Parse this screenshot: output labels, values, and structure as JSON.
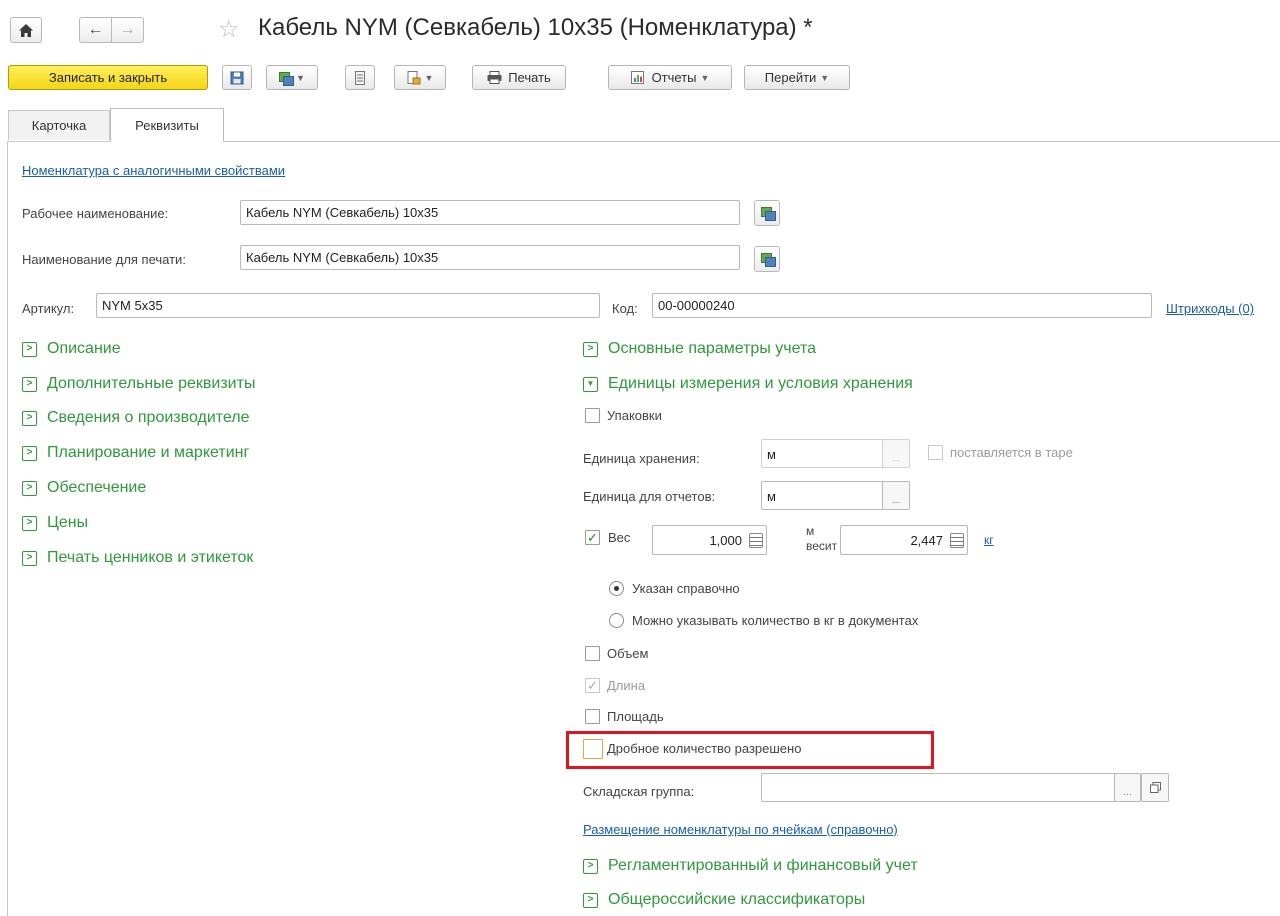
{
  "title_bar": {
    "home_icon": "home-icon",
    "back_icon": "arrow-left-icon",
    "forward_icon": "arrow-right-icon",
    "favorite_icon": "star-icon",
    "title": "Кабель NYM (Севкабель) 10x35 (Номенклатура) *"
  },
  "toolbar": {
    "save_close": "Записать и закрыть",
    "print": "Печать",
    "reports": "Отчеты",
    "goto": "Перейти"
  },
  "tabs": [
    {
      "label": "Карточка",
      "active": false
    },
    {
      "label": "Реквизиты",
      "active": true
    }
  ],
  "form": {
    "similar_link": "Номенклатура с аналогичными свойствами",
    "work_name_label": "Рабочее наименование:",
    "work_name_value": "Кабель NYM (Севкабель) 10x35",
    "print_name_label": "Наименование для печати:",
    "print_name_value": "Кабель NYM (Севкабель) 10x35",
    "article_label": "Артикул:",
    "article_value": "NYM 5x35",
    "code_label": "Код:",
    "code_value": "00-00000240",
    "barcodes_link": "Штрихкоды (0)"
  },
  "left_groups": [
    "Описание",
    "Дополнительные реквизиты",
    "Сведения о производителе",
    "Планирование и маркетинг",
    "Обеспечение",
    "Цены",
    "Печать ценников и этикеток"
  ],
  "right": {
    "group_main": "Основные параметры учета",
    "group_units": "Единицы измерения и условия хранения",
    "packages": {
      "label": "Упаковки",
      "checked": false
    },
    "storage_unit_label": "Единица хранения:",
    "storage_unit_value": "м",
    "in_container": {
      "label": "поставляется в таре",
      "checked": false
    },
    "report_unit_label": "Единица для отчетов:",
    "report_unit_value": "м",
    "weight": {
      "label": "Вес",
      "checked": true,
      "quantity": "1,000",
      "unit_line1": "м",
      "unit_line2": "весит",
      "value": "2,447",
      "unit_link": "кг"
    },
    "radio_reference": {
      "label": "Указан справочно",
      "selected": true
    },
    "radio_docs": {
      "label": "Можно указывать количество в кг в документах",
      "selected": false
    },
    "volume": {
      "label": "Объем",
      "checked": false
    },
    "length": {
      "label": "Длина",
      "checked": true
    },
    "area": {
      "label": "Площадь",
      "checked": false
    },
    "fractional": {
      "label": "Дробное количество разрешено",
      "checked": false
    },
    "warehouse_group_label": "Складская группа:",
    "warehouse_group_value": "",
    "placement_link": "Размещение номенклатуры по ячейкам (справочно)",
    "group_regulated": "Регламентированный и финансовый учет",
    "group_classifiers": "Общероссийские классификаторы"
  },
  "colors": {
    "group_green": "#2e9a3a",
    "link_blue": "#1a5dad",
    "primary_yellow": "#f4d516",
    "highlight_red": "#e3141d"
  }
}
